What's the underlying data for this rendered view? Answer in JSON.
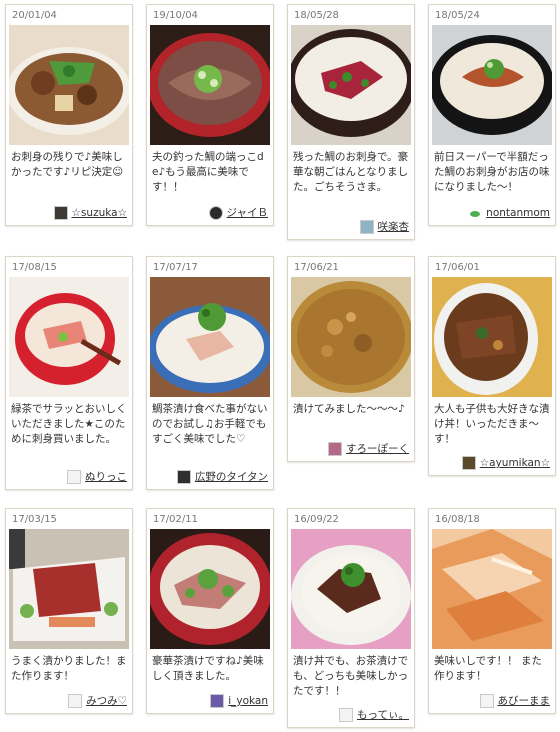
{
  "posts": [
    {
      "date": "20/01/04",
      "comment": "お刺身の残りで♪美味しかったです♪リピ決定☺",
      "author": "☆suzuka☆"
    },
    {
      "date": "19/10/04",
      "comment": "夫の釣った鯛の端っこde♪もう最高に美味です！！",
      "author": "ジャイＢ"
    },
    {
      "date": "18/05/28",
      "comment": "残った鯛のお刺身で。豪華な朝ごはんとなりました。ごちそうさま。",
      "author": "咲楽杏"
    },
    {
      "date": "18/05/24",
      "comment": "前日スーパーで半額だった鯛のお刺身がお店の味になりました～！",
      "author": "nontanmom"
    },
    {
      "date": "17/08/15",
      "comment": "緑茶でサラッとおいしくいただきました★このために刺身買いました。",
      "author": "ぬりっこ"
    },
    {
      "date": "17/07/17",
      "comment": "鯛茶漬け食べた事がないのでお試し♫お手軽でもすごく美味でした♡",
      "author": "広野のタイタン"
    },
    {
      "date": "17/06/21",
      "comment": "漬けてみました～～～♪",
      "author": "すろーぽーく"
    },
    {
      "date": "17/06/01",
      "comment": "大人も子供も大好きな漬け丼！いっただきま～す！",
      "author": "☆ayumikan☆"
    },
    {
      "date": "17/03/15",
      "comment": "うまく漬かりました！また作ります！",
      "author": "みつみ♡"
    },
    {
      "date": "17/02/11",
      "comment": "豪華茶漬けですね♪美味しく頂きました。",
      "author": "i_yokan"
    },
    {
      "date": "16/09/22",
      "comment": "漬け丼でも、お茶漬けでも、どっちも美味しかったです！！",
      "author": "もってぃ。"
    },
    {
      "date": "16/08/18",
      "comment": "美味いしです！！ また作ります！",
      "author": "あびーまま"
    }
  ]
}
